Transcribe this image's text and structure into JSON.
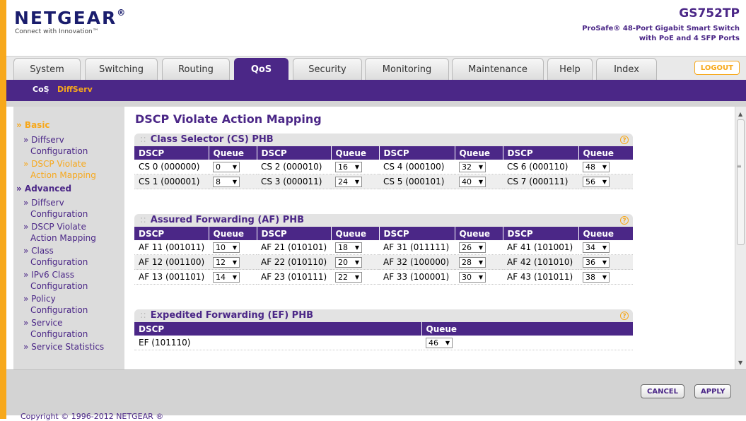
{
  "brand": {
    "logo": "NETGEAR",
    "registered": "®",
    "tagline": "Connect with Innovation™",
    "accent": "#4b2787",
    "orange": "#f7a81b"
  },
  "model": {
    "name": "GS752TP",
    "desc1": "ProSafe® 48-Port Gigabit Smart Switch",
    "desc2": "with PoE and 4 SFP Ports"
  },
  "tabs": [
    "System",
    "Switching",
    "Routing",
    "QoS",
    "Security",
    "Monitoring",
    "Maintenance",
    "Help",
    "Index"
  ],
  "active_tab": "QoS",
  "logout": "LOGOUT",
  "subnav": {
    "item1": "CoS",
    "sep": "|",
    "item2": "DiffServ"
  },
  "sidebar": {
    "basic": "» Basic",
    "b1a": "» Diffserv",
    "b1b": "Configuration",
    "b2a": "» DSCP Violate",
    "b2b": "Action Mapping",
    "advanced": "» Advanced",
    "a1a": "» Diffserv",
    "a1b": "Configuration",
    "a2a": "» DSCP Violate",
    "a2b": "Action Mapping",
    "a3a": "» Class",
    "a3b": "Configuration",
    "a4a": "» IPv6 Class",
    "a4b": "Configuration",
    "a5a": "» Policy",
    "a5b": "Configuration",
    "a6a": "» Service",
    "a6b": "Configuration",
    "a7": "» Service Statistics"
  },
  "page_title": "DSCP Violate Action Mapping",
  "cs": {
    "title": "Class Selector (CS) PHB",
    "headers": [
      "DSCP",
      "Queue",
      "DSCP",
      "Queue",
      "DSCP",
      "Queue",
      "DSCP",
      "Queue"
    ],
    "rows": [
      [
        [
          "CS 0 (000000)",
          "0"
        ],
        [
          "CS 2 (000010)",
          "16"
        ],
        [
          "CS 4 (000100)",
          "32"
        ],
        [
          "CS 6 (000110)",
          "48"
        ]
      ],
      [
        [
          "CS 1 (000001)",
          "8"
        ],
        [
          "CS 3 (000011)",
          "24"
        ],
        [
          "CS 5 (000101)",
          "40"
        ],
        [
          "CS 7 (000111)",
          "56"
        ]
      ]
    ]
  },
  "af": {
    "title": "Assured Forwarding (AF) PHB",
    "headers": [
      "DSCP",
      "Queue",
      "DSCP",
      "Queue",
      "DSCP",
      "Queue",
      "DSCP",
      "Queue"
    ],
    "rows": [
      [
        [
          "AF 11 (001011)",
          "10"
        ],
        [
          "AF 21 (010101)",
          "18"
        ],
        [
          "AF 31 (011111)",
          "26"
        ],
        [
          "AF 41 (101001)",
          "34"
        ]
      ],
      [
        [
          "AF 12 (001100)",
          "12"
        ],
        [
          "AF 22 (010110)",
          "20"
        ],
        [
          "AF 32 (100000)",
          "28"
        ],
        [
          "AF 42 (101010)",
          "36"
        ]
      ],
      [
        [
          "AF 13 (001101)",
          "14"
        ],
        [
          "AF 23 (010111)",
          "22"
        ],
        [
          "AF 33 (100001)",
          "30"
        ],
        [
          "AF 43 (101011)",
          "38"
        ]
      ]
    ]
  },
  "ef": {
    "title": "Expedited Forwarding (EF) PHB",
    "headers": [
      "DSCP",
      "Queue"
    ],
    "row": [
      "EF (101110)",
      "46"
    ]
  },
  "help_glyph": "?",
  "buttons": {
    "cancel": "CANCEL",
    "apply": "APPLY"
  },
  "copyright": "Copyright © 1996-2012 NETGEAR ®"
}
